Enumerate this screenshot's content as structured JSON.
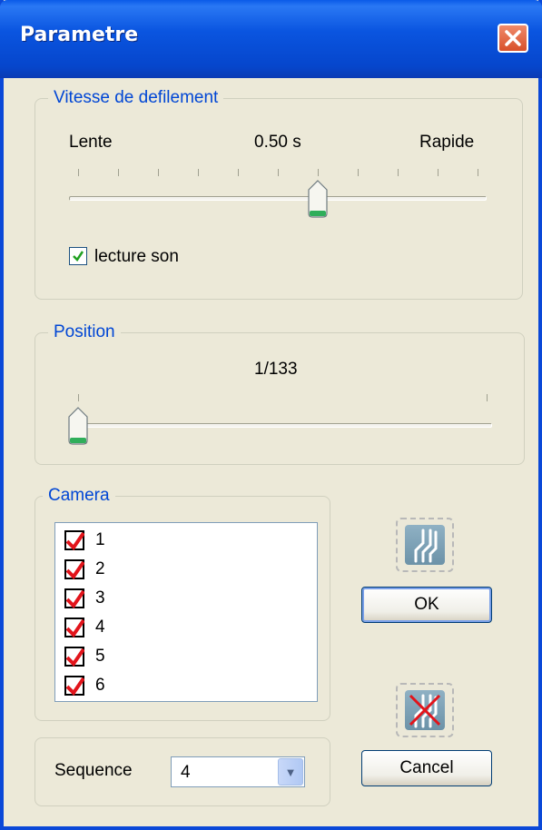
{
  "window": {
    "title": "Parametre"
  },
  "speed_group": {
    "legend": "Vitesse de defilement",
    "min_label": "Lente",
    "value_label": "0.50 s",
    "max_label": "Rapide",
    "slider_fraction": 0.6,
    "play_sound": {
      "label": "lecture son",
      "checked": true
    }
  },
  "position_group": {
    "legend": "Position",
    "value_label": "1/133",
    "slider_fraction": 0.0
  },
  "camera_group": {
    "legend": "Camera",
    "items": [
      {
        "label": "1",
        "checked": true
      },
      {
        "label": "2",
        "checked": true
      },
      {
        "label": "3",
        "checked": true
      },
      {
        "label": "4",
        "checked": true
      },
      {
        "label": "5",
        "checked": true
      },
      {
        "label": "6",
        "checked": true
      }
    ]
  },
  "sequence_group": {
    "label": "Sequence",
    "selected": "4"
  },
  "buttons": {
    "ok": "OK",
    "cancel": "Cancel"
  },
  "icons": {
    "close": "close-icon",
    "ok_image": "ok-circuit-icon",
    "cancel_image": "cancel-circuit-icon",
    "scroll_up": "chevron-up-icon",
    "scroll_down": "chevron-down-icon",
    "combo_dropdown": "chevron-down-icon"
  },
  "colors": {
    "titlebar": "#0a55e0",
    "dialog_bg": "#ece9d8",
    "group_legend": "#0046d5",
    "check_mark": "#e2141b",
    "checkbox_tick": "#21a121",
    "close_button": "#d8502a"
  }
}
